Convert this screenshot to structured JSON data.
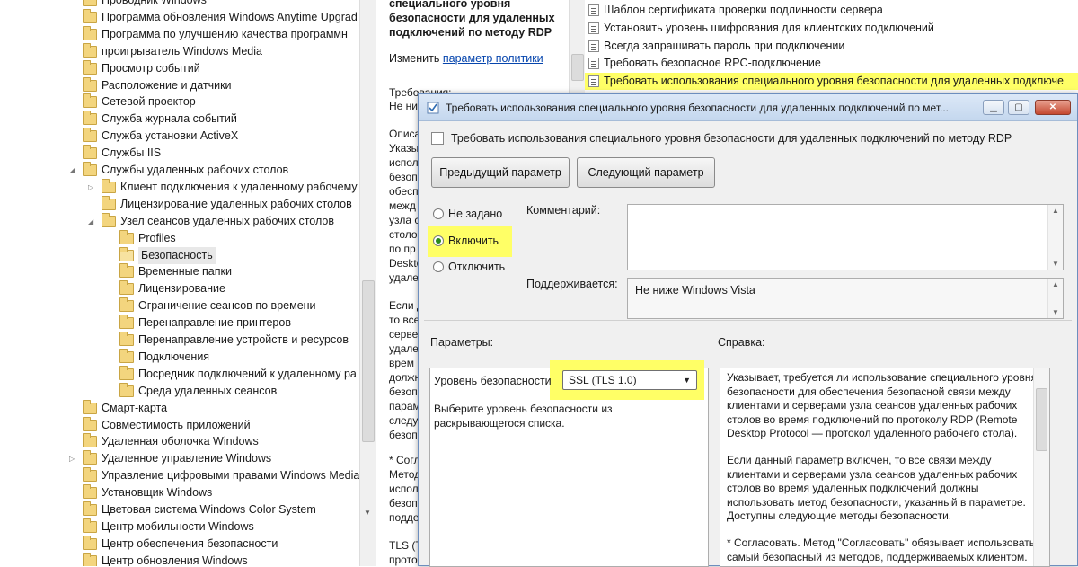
{
  "tree": {
    "items": [
      {
        "label": "Проводник Windows",
        "level": 0,
        "expander": ""
      },
      {
        "label": "Программа обновления Windows Anytime Upgrad",
        "level": 0,
        "expander": ""
      },
      {
        "label": "Программа по улучшению качества программн",
        "level": 0,
        "expander": ""
      },
      {
        "label": "проигрыватель Windows Media",
        "level": 0,
        "expander": ""
      },
      {
        "label": "Просмотр событий",
        "level": 0,
        "expander": ""
      },
      {
        "label": "Расположение и датчики",
        "level": 0,
        "expander": ""
      },
      {
        "label": "Сетевой проектор",
        "level": 0,
        "expander": ""
      },
      {
        "label": "Служба журнала событий",
        "level": 0,
        "expander": ""
      },
      {
        "label": "Служба установки ActiveX",
        "level": 0,
        "expander": ""
      },
      {
        "label": "Службы IIS",
        "level": 0,
        "expander": ""
      },
      {
        "label": "Службы удаленных рабочих столов",
        "level": 0,
        "expander": "◢"
      },
      {
        "label": "Клиент подключения к удаленному рабочему",
        "level": 1,
        "expander": "▷"
      },
      {
        "label": "Лицензирование удаленных рабочих столов",
        "level": 1,
        "expander": ""
      },
      {
        "label": "Узел сеансов удаленных рабочих столов",
        "level": 1,
        "expander": "◢"
      },
      {
        "label": "Profiles",
        "level": 2,
        "expander": ""
      },
      {
        "label": "Безопасность",
        "level": 2,
        "expander": "",
        "selected": true
      },
      {
        "label": "Временные папки",
        "level": 2,
        "expander": ""
      },
      {
        "label": "Лицензирование",
        "level": 2,
        "expander": ""
      },
      {
        "label": "Ограничение сеансов по времени",
        "level": 2,
        "expander": ""
      },
      {
        "label": "Перенаправление принтеров",
        "level": 2,
        "expander": ""
      },
      {
        "label": "Перенаправление устройств и ресурсов",
        "level": 2,
        "expander": ""
      },
      {
        "label": "Подключения",
        "level": 2,
        "expander": ""
      },
      {
        "label": "Посредник подключений к удаленному ра",
        "level": 2,
        "expander": ""
      },
      {
        "label": "Среда удаленных сеансов",
        "level": 2,
        "expander": ""
      },
      {
        "label": "Смарт-карта",
        "level": 0,
        "expander": ""
      },
      {
        "label": "Совместимость приложений",
        "level": 0,
        "expander": ""
      },
      {
        "label": "Удаленная оболочка Windows",
        "level": 0,
        "expander": ""
      },
      {
        "label": "Удаленное управление Windows",
        "level": 0,
        "expander": "▷"
      },
      {
        "label": "Управление цифровыми правами Windows Media",
        "level": 0,
        "expander": ""
      },
      {
        "label": "Установщик Windows",
        "level": 0,
        "expander": ""
      },
      {
        "label": "Цветовая система Windows Color System",
        "level": 0,
        "expander": ""
      },
      {
        "label": "Центр мобильности Windows",
        "level": 0,
        "expander": ""
      },
      {
        "label": "Центр обеспечения безопасности",
        "level": 0,
        "expander": ""
      },
      {
        "label": "Центр обновления Windows",
        "level": 0,
        "expander": ""
      }
    ]
  },
  "description": {
    "title": "специального уровня безопасности для удаленных подключений по методу RDP",
    "edit_prefix": "Изменить",
    "edit_link": "параметр политики",
    "fragments": [
      {
        "text": "Требования:"
      },
      {
        "text": "Не ни"
      },
      {
        "text": "Описа"
      },
      {
        "text": "Указы"
      },
      {
        "text": "исполь"
      },
      {
        "text": "безоп"
      },
      {
        "text": "обесп"
      },
      {
        "text": "межд"
      },
      {
        "text": "узла с"
      },
      {
        "text": "столо"
      },
      {
        "text": "по пр"
      },
      {
        "text": "Deskto"
      },
      {
        "text": "удале"
      },
      {
        "text": "Если д"
      },
      {
        "text": "то все"
      },
      {
        "text": "серве"
      },
      {
        "text": "удале"
      },
      {
        "text": "врем"
      },
      {
        "text": "должн"
      },
      {
        "text": "безоп"
      },
      {
        "text": "парам"
      },
      {
        "text": "следу"
      },
      {
        "text": "безоп"
      },
      {
        "text": "* Согл"
      },
      {
        "text": "Метод"
      },
      {
        "text": "исполь"
      },
      {
        "text": "безоп"
      },
      {
        "text": "подде"
      },
      {
        "text": "TLS (T"
      },
      {
        "text": "прото"
      }
    ]
  },
  "settings": {
    "rows": [
      {
        "label": "Шаблон сертификата проверки подлинности сервера"
      },
      {
        "label": "Установить уровень шифрования для клиентских подключений"
      },
      {
        "label": "Всегда запрашивать пароль при подключении"
      },
      {
        "label": "Требовать безопасное RPC-подключение"
      },
      {
        "label": "Требовать использования специального уровня безопасности для удаленных подключе",
        "highlight": true
      }
    ]
  },
  "dialog": {
    "title": "Требовать использования специального уровня безопасности для удаленных подключений по мет...",
    "header": "Требовать использования специального уровня безопасности для удаленных подключений по методу RDP",
    "prev_button": "Предыдущий параметр",
    "next_button": "Следующий параметр",
    "radio_not_set": "Не задано",
    "radio_enable": "Включить",
    "radio_disable": "Отключить",
    "selected_radio": "enable",
    "comment_label": "Комментарий:",
    "comment_value": "",
    "supported_label": "Поддерживается:",
    "supported_value": "Не ниже Windows Vista",
    "params_label": "Параметры:",
    "help_label": "Справка:",
    "security_level_label": "Уровень безопасности",
    "security_level_value": "SSL (TLS 1.0)",
    "params_hint": "Выберите уровень безопасности из раскрывающегося списка.",
    "help_paragraphs": [
      "Указывает, требуется ли использование специального уровня безопасности для обеспечения безопасной связи между клиентами и серверами узла сеансов удаленных рабочих столов во время подключений по протоколу RDP (Remote Desktop Protocol — протокол удаленного рабочего стола).",
      "Если данный параметр включен, то все связи между клиентами и серверами узла сеансов удаленных рабочих столов во время удаленных подключений должны использовать метод безопасности, указанный в параметре. Доступны следующие методы безопасности.",
      "* Согласовать. Метод \"Согласовать\" обязывает использовать самый безопасный из методов, поддерживаемых клиентом."
    ]
  },
  "colors": {
    "highlight": "#ffff66",
    "title_bar": "#c4d7ee",
    "folder": "#f3d57e",
    "link": "#0645ad"
  }
}
